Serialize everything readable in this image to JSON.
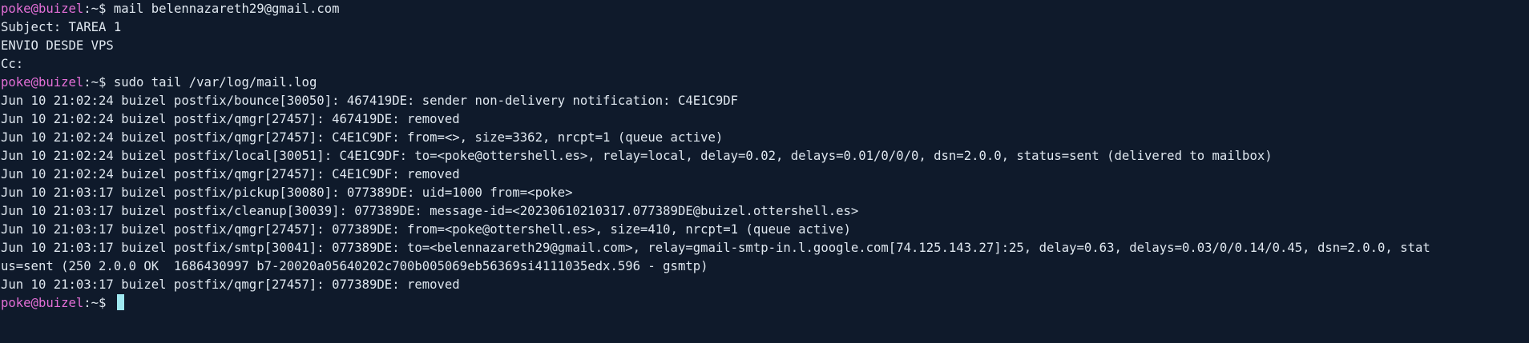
{
  "colors": {
    "background": "#0f1a2b",
    "text": "#dfe7ef",
    "user_host": "#e36fd6",
    "cursor": "#9fe8f0"
  },
  "prompt": {
    "user_host": "poke@buizel",
    "path": ":~$ "
  },
  "lines": [
    {
      "type": "prompt",
      "command": "mail belennazareth29@gmail.com"
    },
    {
      "type": "output",
      "text": "Subject: TAREA 1"
    },
    {
      "type": "output",
      "text": "ENVIO DESDE VPS"
    },
    {
      "type": "output",
      "text": "Cc:"
    },
    {
      "type": "prompt",
      "command": "sudo tail /var/log/mail.log"
    },
    {
      "type": "output",
      "text": "Jun 10 21:02:24 buizel postfix/bounce[30050]: 467419DE: sender non-delivery notification: C4E1C9DF"
    },
    {
      "type": "output",
      "text": "Jun 10 21:02:24 buizel postfix/qmgr[27457]: 467419DE: removed"
    },
    {
      "type": "output",
      "text": "Jun 10 21:02:24 buizel postfix/qmgr[27457]: C4E1C9DF: from=<>, size=3362, nrcpt=1 (queue active)"
    },
    {
      "type": "output",
      "text": "Jun 10 21:02:24 buizel postfix/local[30051]: C4E1C9DF: to=<poke@ottershell.es>, relay=local, delay=0.02, delays=0.01/0/0/0, dsn=2.0.0, status=sent (delivered to mailbox)"
    },
    {
      "type": "output",
      "text": "Jun 10 21:02:24 buizel postfix/qmgr[27457]: C4E1C9DF: removed"
    },
    {
      "type": "output",
      "text": "Jun 10 21:03:17 buizel postfix/pickup[30080]: 077389DE: uid=1000 from=<poke>"
    },
    {
      "type": "output",
      "text": "Jun 10 21:03:17 buizel postfix/cleanup[30039]: 077389DE: message-id=<20230610210317.077389DE@buizel.ottershell.es>"
    },
    {
      "type": "output",
      "text": "Jun 10 21:03:17 buizel postfix/qmgr[27457]: 077389DE: from=<poke@ottershell.es>, size=410, nrcpt=1 (queue active)"
    },
    {
      "type": "output",
      "text": "Jun 10 21:03:17 buizel postfix/smtp[30041]: 077389DE: to=<belennazareth29@gmail.com>, relay=gmail-smtp-in.l.google.com[74.125.143.27]:25, delay=0.63, delays=0.03/0/0.14/0.45, dsn=2.0.0, stat"
    },
    {
      "type": "output",
      "text": "us=sent (250 2.0.0 OK  1686430997 b7-20020a05640202c700b005069eb56369si4111035edx.596 - gsmtp)"
    },
    {
      "type": "output",
      "text": "Jun 10 21:03:17 buizel postfix/qmgr[27457]: 077389DE: removed"
    },
    {
      "type": "prompt",
      "command": "",
      "cursor": true
    }
  ]
}
